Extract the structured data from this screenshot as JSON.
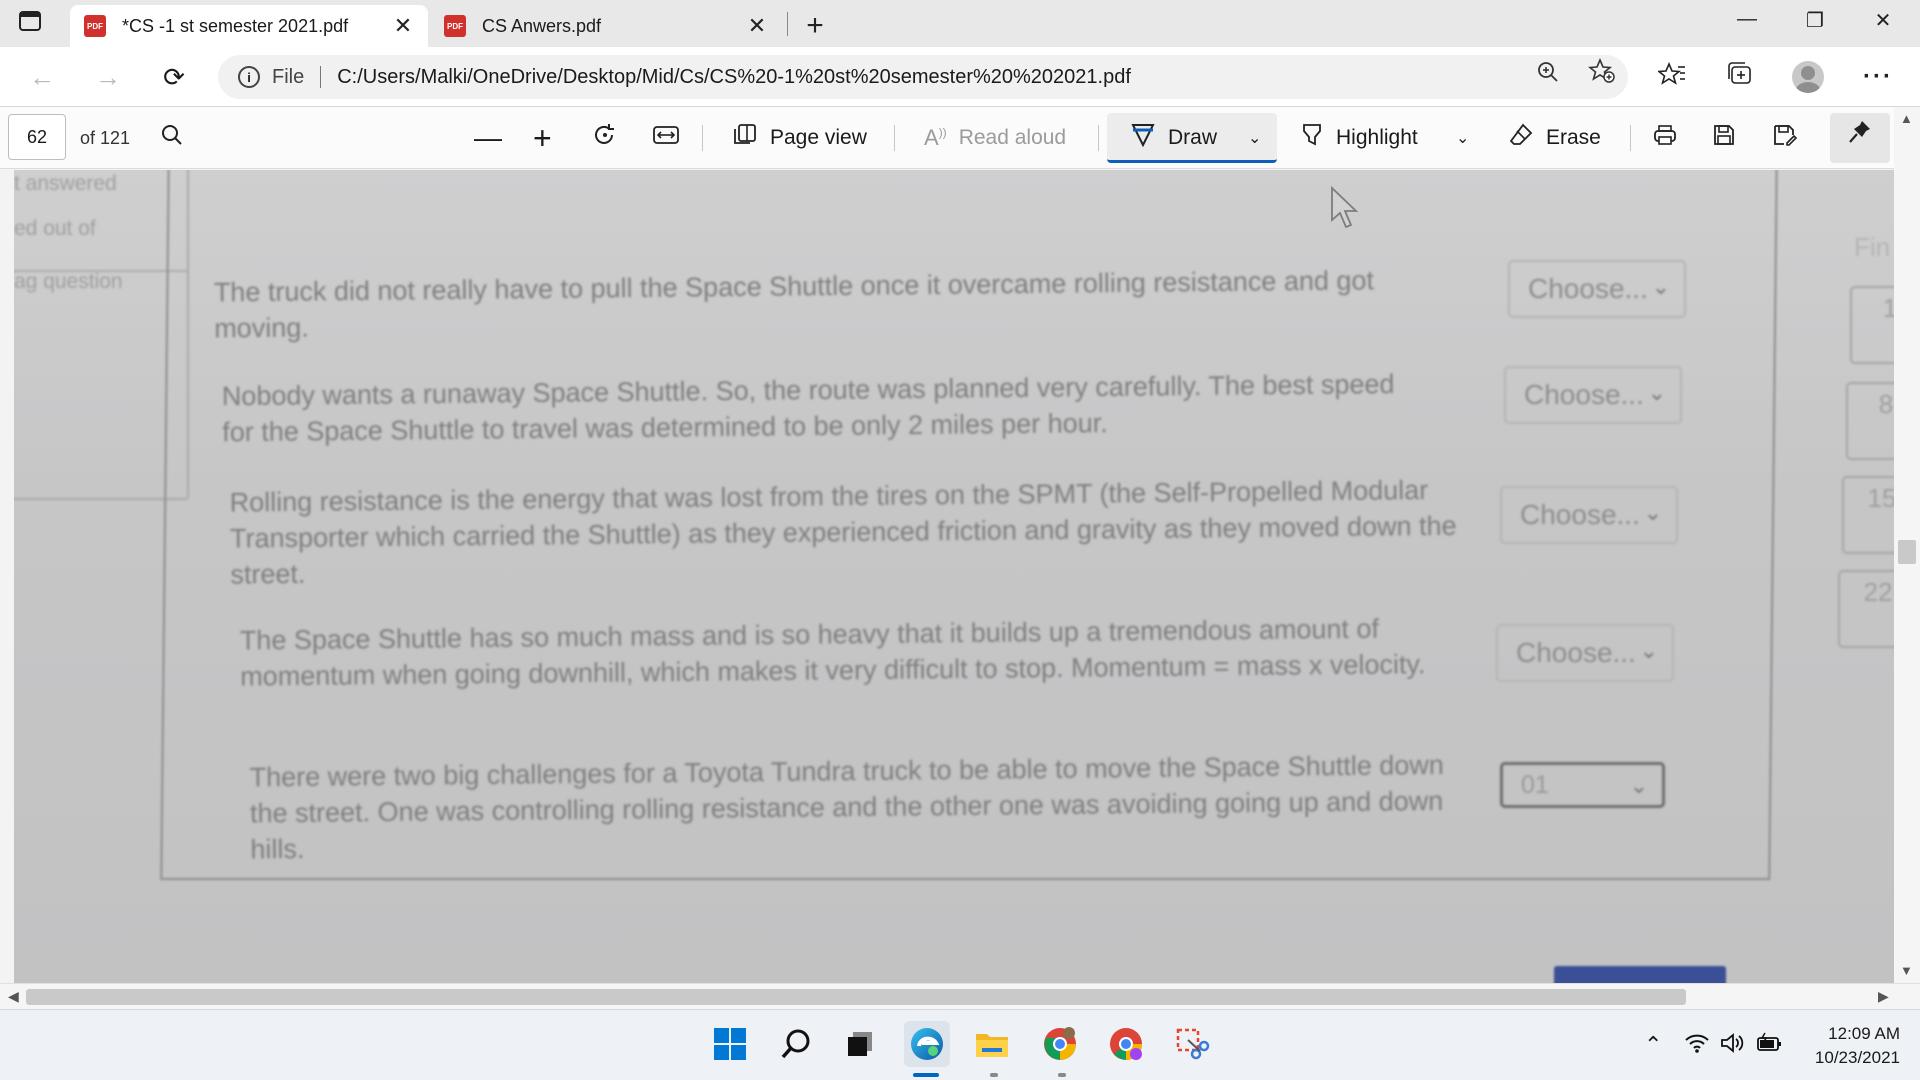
{
  "browser": {
    "tabs": [
      {
        "title": "*CS -1 st semester 2021.pdf",
        "icon": "pdf-icon",
        "active": true
      },
      {
        "title": "CS Anwers.pdf",
        "icon": "pdf-icon",
        "active": false
      }
    ],
    "pdf_icon_text": "PDF",
    "new_tab": "+",
    "close_glyph": "✕",
    "address": {
      "scheme_label": "File",
      "url": "C:/Users/Malki/OneDrive/Desktop/Mid/Cs/CS%20-1%20st%20semester%20%202021.pdf"
    }
  },
  "pdf_toolbar": {
    "page_number": "62",
    "page_total": "of 121",
    "page_view": "Page view",
    "read_aloud": "Read aloud",
    "draw": "Draw",
    "highlight": "Highlight",
    "erase": "Erase",
    "accent_color": "#0f5fb8"
  },
  "document": {
    "sidebar": {
      "line1": "t answered",
      "line2": "ed out of",
      "line3": "ag question"
    },
    "questions": [
      {
        "text": "The truck did not really have to pull the Space Shuttle once it overcame rolling resistance and got moving.",
        "answer": "Choose..."
      },
      {
        "text": "Nobody wants a runaway Space Shuttle. So, the route was planned very carefully. The best speed for the Space Shuttle to travel was determined to be only 2 miles per hour.",
        "answer": "Choose..."
      },
      {
        "text": "Rolling resistance is the energy that was lost from the tires on the SPMT (the Self-Propelled Modular Transporter which carried the Shuttle) as they experienced friction and gravity as they moved down the street.",
        "answer": "Choose..."
      },
      {
        "text": "The Space Shuttle has so much mass and is so heavy that it builds up a tremendous amount of momentum when going downhill, which makes it very difficult to stop. Momentum = mass x velocity.",
        "answer": "Choose..."
      },
      {
        "text": "There were two big challenges for a Toyota Tundra truck to be able to move the Space Shuttle down the street. One was controlling rolling resistance and the other one was avoiding going up and down hills.",
        "answer": "01"
      }
    ],
    "right_nav": {
      "label": "Fin",
      "numbers": [
        "1",
        "8",
        "15",
        "22"
      ]
    }
  },
  "taskbar": {
    "apps": [
      "windows-start-icon",
      "search-icon",
      "task-view-icon",
      "edge-icon",
      "file-explorer-icon",
      "chrome-icon",
      "chrome-profile-icon",
      "snipping-tool-icon"
    ],
    "time": "12:09 AM",
    "date": "10/23/2021"
  }
}
